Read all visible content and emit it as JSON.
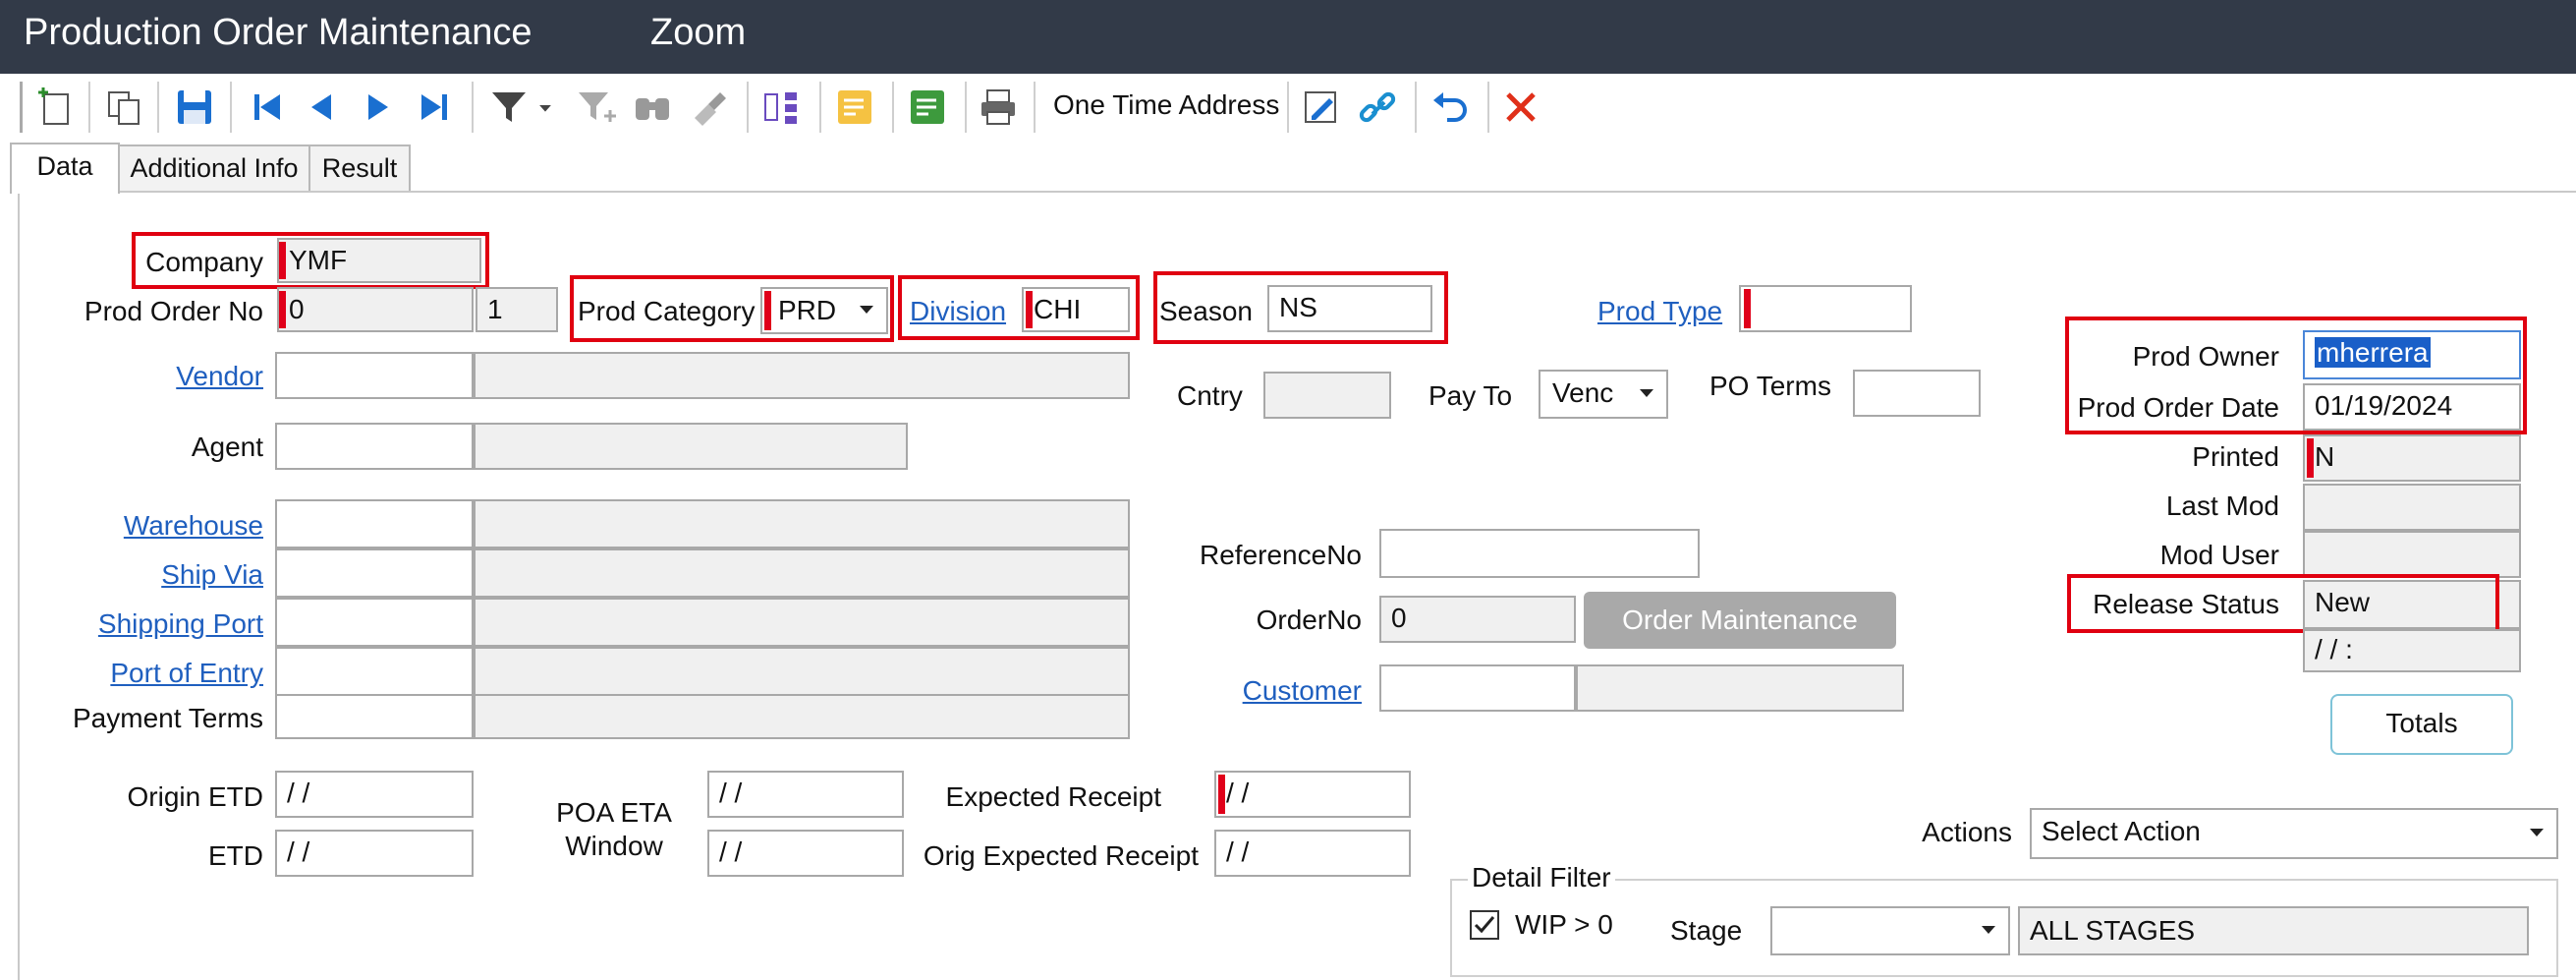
{
  "window": {
    "title": "Production Order Maintenance",
    "zoom": "Zoom"
  },
  "toolbar": {
    "one_time_address": "One Time Address",
    "icons": [
      "new-icon",
      "copy-icon",
      "save-icon",
      "first-record-icon",
      "prev-record-icon",
      "next-record-icon",
      "last-record-icon",
      "filter-icon",
      "filter-dropdown-icon",
      "filter-add-icon",
      "find-icon",
      "clear-filter-icon",
      "tree-icon",
      "note-icon",
      "notes-green-icon",
      "print-icon",
      "edit-doc-icon",
      "link-icon",
      "undo-icon",
      "delete-icon"
    ]
  },
  "tabs": [
    "Data",
    "Additional Info",
    "Result"
  ],
  "form": {
    "company_label": "Company",
    "company": "YMF",
    "prod_order_no_label": "Prod Order No",
    "prod_order_no": "0",
    "prod_order_seq": "1",
    "prod_category_label": "Prod Category",
    "prod_category": "PRD",
    "division_label": "Division",
    "division": "CHI",
    "season_label": "Season",
    "season": "NS",
    "prod_type_label": "Prod Type",
    "prod_type": "",
    "vendor_label": "Vendor",
    "agent_label": "Agent",
    "cntry_label": "Cntry",
    "pay_to_label": "Pay To",
    "pay_to": "Venc",
    "po_terms_label": "PO Terms",
    "warehouse_label": "Warehouse",
    "ship_via_label": "Ship Via",
    "shipping_port_label": "Shipping Port",
    "port_of_entry_label": "Port of Entry",
    "payment_terms_label": "Payment Terms",
    "reference_no_label": "ReferenceNo",
    "order_no_label": "OrderNo",
    "order_no": "0",
    "order_maintenance_button": "Order Maintenance",
    "customer_label": "Customer",
    "prod_owner_label": "Prod Owner",
    "prod_owner": "mherrera",
    "prod_order_date_label": "Prod Order Date",
    "prod_order_date": "01/19/2024",
    "printed_label": "Printed",
    "printed": "N",
    "last_mod_label": "Last Mod",
    "mod_user_label": "Mod User",
    "release_status_label": "Release Status",
    "release_status": "New",
    "release_date": " /  /      :",
    "totals_button": "Totals",
    "origin_etd_label": "Origin ETD",
    "origin_etd": " /  /",
    "etd_label": "ETD",
    "etd": " /  /",
    "poa_eta_label_1": "POA ETA",
    "poa_eta_label_2": "Window",
    "poa_eta_1": " /  /",
    "poa_eta_2": " /  /",
    "expected_receipt_label": "Expected Receipt",
    "expected_receipt": " /  /",
    "orig_expected_receipt_label": "Orig Expected Receipt",
    "orig_expected_receipt": " /  /",
    "actions_label": "Actions",
    "actions_value": "Select Action",
    "detail_filter_label": "Detail Filter",
    "wip_label": "WIP > 0",
    "stage_label": "Stage",
    "stage_value": "",
    "stage_desc": "ALL STAGES"
  },
  "colors": {
    "title_bar": "#323a48",
    "highlight": "#e00010",
    "required": "#e0001a",
    "link": "#1f5fbf"
  }
}
